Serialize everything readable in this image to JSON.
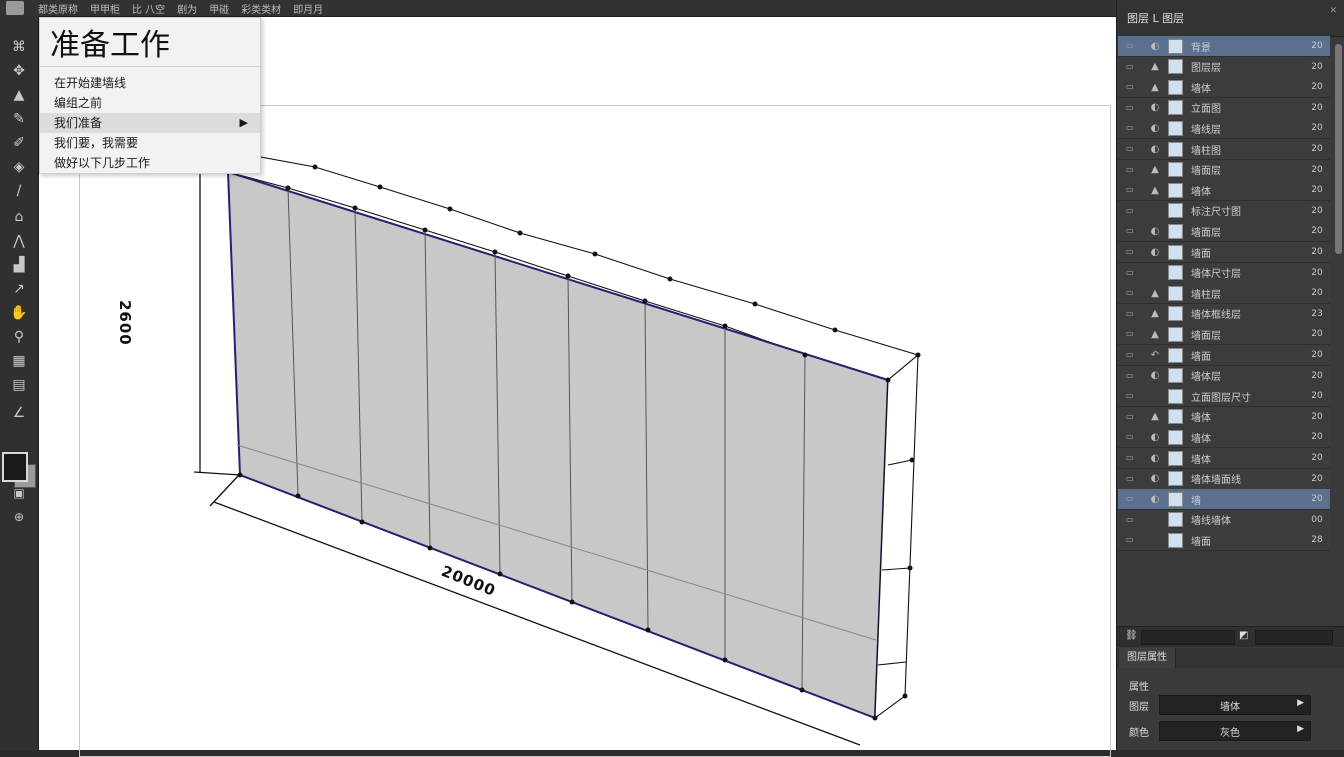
{
  "menubar": {
    "items": [
      "都类原称",
      "甲甲柜",
      "比 八空",
      "剧为",
      "甲碰",
      "彩类类材",
      "即月月"
    ]
  },
  "tools": [
    {
      "icon": "lasso-icon",
      "glyph": "⌘"
    },
    {
      "icon": "move-icon",
      "glyph": "✥"
    },
    {
      "icon": "shape-icon",
      "glyph": "▲"
    },
    {
      "icon": "brush-icon",
      "glyph": "✎"
    },
    {
      "icon": "eraser-icon",
      "glyph": "✐"
    },
    {
      "icon": "bucket-icon",
      "glyph": "◈"
    },
    {
      "icon": "pen-icon",
      "glyph": "/"
    },
    {
      "icon": "wall-tool-icon",
      "glyph": "⌂"
    },
    {
      "icon": "line-tool-icon",
      "glyph": "⋀"
    },
    {
      "icon": "stamp-icon",
      "glyph": "▟"
    },
    {
      "icon": "curve-icon",
      "glyph": "↗"
    },
    {
      "icon": "hand-icon",
      "glyph": "✋"
    },
    {
      "icon": "zoom-icon",
      "glyph": "⚲"
    },
    {
      "icon": "grid-icon",
      "glyph": "▦"
    },
    {
      "icon": "text-icon",
      "glyph": "▤"
    },
    {
      "icon": "angle-icon",
      "glyph": "∠"
    }
  ],
  "context_menu": {
    "title": "准备工作",
    "items": [
      {
        "label": "在开始建墙线",
        "submenu": false
      },
      {
        "label": "编组之前",
        "submenu": false
      },
      {
        "label": "我们准备",
        "submenu": true,
        "highlighted": true
      },
      {
        "label": "我们要，我需要",
        "submenu": false
      },
      {
        "label": "做好以下几步工作",
        "submenu": false
      }
    ]
  },
  "drawing": {
    "height_dim": "2600",
    "width_dim": "20000",
    "wall_fill": "#c8c8c8",
    "edge_color": "#2a1e6e"
  },
  "layers_panel": {
    "header": "图层  L 图层",
    "layers": [
      {
        "name": "背景",
        "value": "20",
        "selected": true,
        "fx": "◐"
      },
      {
        "name": "图层层",
        "value": "20",
        "selected": false,
        "fx": "▲"
      },
      {
        "name": "墙体",
        "value": "20",
        "selected": false,
        "fx": "▲"
      },
      {
        "name": "立面图",
        "value": "20",
        "selected": false,
        "fx": "◐"
      },
      {
        "name": "墙线层",
        "value": "20",
        "selected": false,
        "fx": "◐"
      },
      {
        "name": "墙柱图",
        "value": "20",
        "selected": false,
        "fx": "◐"
      },
      {
        "name": "墙面层",
        "value": "20",
        "selected": false,
        "fx": "▲"
      },
      {
        "name": "墙体",
        "value": "20",
        "selected": false,
        "fx": "▲"
      },
      {
        "name": "标注尺寸图",
        "value": "20",
        "selected": false,
        "fx": ""
      },
      {
        "name": "墙面层",
        "value": "20",
        "selected": false,
        "fx": "◐"
      },
      {
        "name": "墙面",
        "value": "20",
        "selected": false,
        "fx": "◐"
      },
      {
        "name": "墙体尺寸层",
        "value": "20",
        "selected": false,
        "fx": ""
      },
      {
        "name": "墙柱层",
        "value": "20",
        "selected": false,
        "fx": "▲"
      },
      {
        "name": "墙体框线层",
        "value": "23",
        "selected": false,
        "fx": "▲"
      },
      {
        "name": "墙面层",
        "value": "20",
        "selected": false,
        "fx": "▲"
      },
      {
        "name": "墙面",
        "value": "20",
        "selected": false,
        "fx": "↶"
      },
      {
        "name": "墙体层",
        "value": "20",
        "selected": false,
        "fx": "◐"
      },
      {
        "name": "立面图层尺寸",
        "value": "20",
        "selected": false,
        "fx": ""
      },
      {
        "name": "墙体",
        "value": "20",
        "selected": false,
        "fx": "▲"
      },
      {
        "name": "墙体",
        "value": "20",
        "selected": false,
        "fx": "◐"
      },
      {
        "name": "墙体",
        "value": "20",
        "selected": false,
        "fx": "◐"
      },
      {
        "name": "墙体墙面线",
        "value": "20",
        "selected": false,
        "fx": "◐"
      },
      {
        "name": "墙",
        "value": "20",
        "selected": true,
        "fx": "◐"
      },
      {
        "name": "墙线墙体",
        "value": "00",
        "selected": false,
        "fx": ""
      },
      {
        "name": "墙面",
        "value": "28",
        "selected": false,
        "fx": ""
      }
    ]
  },
  "properties": {
    "tab": "图层属性",
    "section": "属性",
    "rows": [
      {
        "label": "图层",
        "value": "墙体"
      },
      {
        "label": "颜色",
        "value": "灰色"
      }
    ]
  }
}
